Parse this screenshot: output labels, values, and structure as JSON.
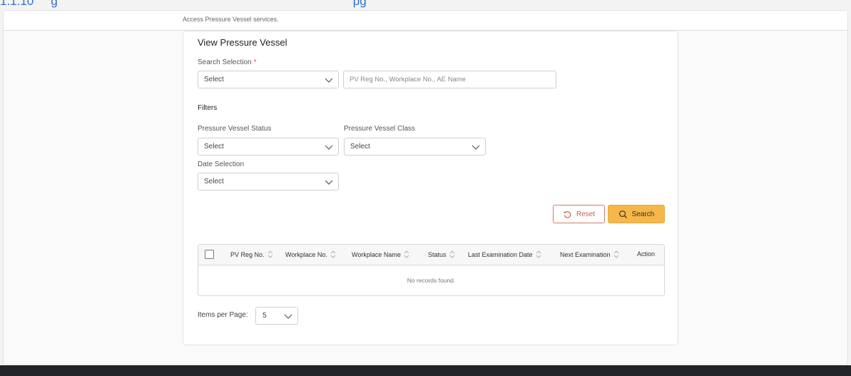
{
  "header": {
    "top_caption_left": "1.1.10",
    "top_caption_mid": "g",
    "top_caption_right": "pg",
    "subtitle": "Access Pressure Vessel services."
  },
  "card": {
    "title": "View Pressure Vessel",
    "search_selection_label": "Search Selection",
    "required_mark": "*",
    "search_selection_value": "Select",
    "search_placeholder": "PV Reg No., Workplace No., AE Name",
    "filters_label": "Filters",
    "status_label": "Pressure Vessel Status",
    "status_value": "Select",
    "class_label": "Pressure Vessel Class",
    "class_value": "Select",
    "date_label": "Date Selection",
    "date_value": "Select",
    "reset_label": "Reset",
    "search_label": "Search"
  },
  "table": {
    "columns": [
      "PV Reg No.",
      "Workplace No.",
      "Workplace Name",
      "Status",
      "Last Examination Date",
      "Next Examination",
      "Action"
    ],
    "empty_message": "No records found."
  },
  "pagination": {
    "items_per_page_label": "Items per Page:",
    "items_per_page_value": "5"
  },
  "colors": {
    "accent": "#f5b64b",
    "reset": "#c85e3f",
    "footer": "#222428"
  },
  "icons": {
    "reset": "reset-icon",
    "search": "search-icon",
    "chevron": "chevron-down-icon",
    "sort": "sort-icon"
  }
}
